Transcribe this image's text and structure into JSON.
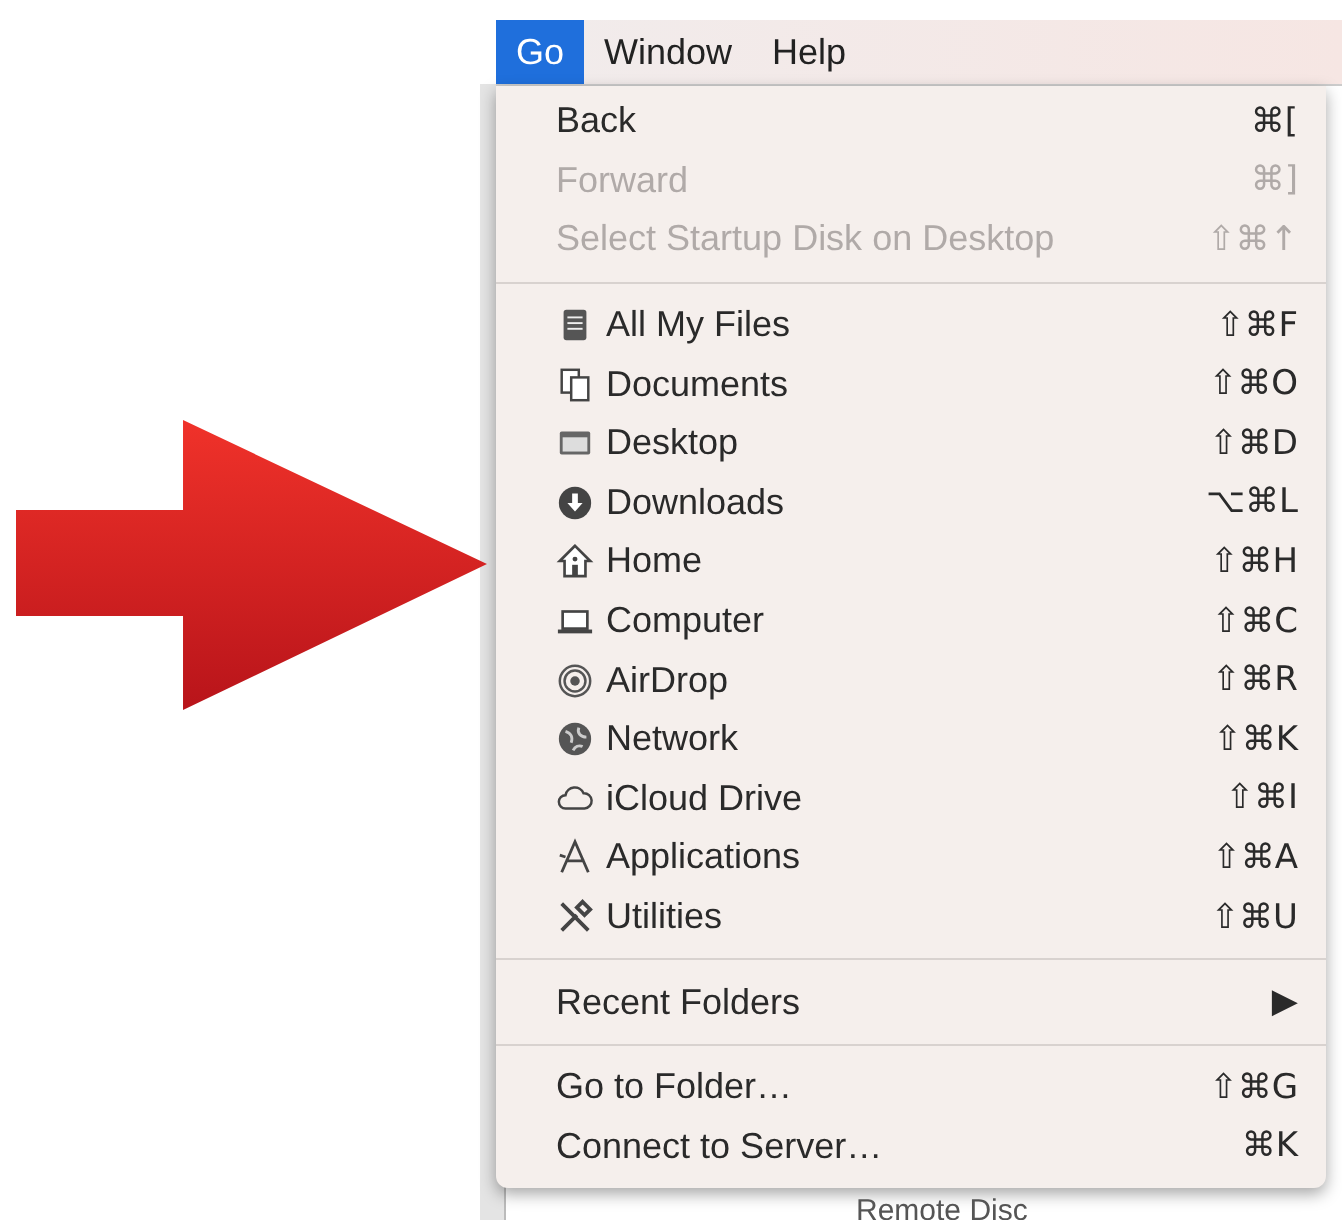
{
  "menu_bar": [
    {
      "label": "Go",
      "selected": true
    },
    {
      "label": "Window",
      "selected": false
    },
    {
      "label": "Help",
      "selected": false
    }
  ],
  "menu": {
    "sections": [
      {
        "items": [
          {
            "label": "Back",
            "shortcut": "⌘[",
            "disabled": false
          },
          {
            "label": "Forward",
            "shortcut": "⌘]",
            "disabled": true
          },
          {
            "label": "Select Startup Disk on Desktop",
            "shortcut": "⇧⌘↑",
            "disabled": true
          }
        ]
      },
      {
        "items": [
          {
            "label": "All My Files",
            "shortcut": "⇧⌘F",
            "disabled": false
          },
          {
            "label": "Documents",
            "shortcut": "⇧⌘O",
            "disabled": false
          },
          {
            "label": "Desktop",
            "shortcut": "⇧⌘D",
            "disabled": false
          },
          {
            "label": "Downloads",
            "shortcut": "⌥⌘L",
            "disabled": false
          },
          {
            "label": "Home",
            "shortcut": "⇧⌘H",
            "disabled": false
          },
          {
            "label": "Computer",
            "shortcut": "⇧⌘C",
            "disabled": false
          },
          {
            "label": "AirDrop",
            "shortcut": "⇧⌘R",
            "disabled": false
          },
          {
            "label": "Network",
            "shortcut": "⇧⌘K",
            "disabled": false
          },
          {
            "label": "iCloud Drive",
            "shortcut": "⇧⌘I",
            "disabled": false
          },
          {
            "label": "Applications",
            "shortcut": "⇧⌘A",
            "disabled": false
          },
          {
            "label": "Utilities",
            "shortcut": "⇧⌘U",
            "disabled": false
          }
        ]
      },
      {
        "items": [
          {
            "label": "Recent Folders",
            "shortcut": "▶",
            "disabled": false
          }
        ]
      },
      {
        "items": [
          {
            "label": "Go to Folder…",
            "shortcut": "⇧⌘G",
            "disabled": false
          },
          {
            "label": "Connect to Server…",
            "shortcut": "⌘K",
            "disabled": false
          }
        ]
      }
    ]
  },
  "background_window": {
    "item": "Remote Disc"
  }
}
